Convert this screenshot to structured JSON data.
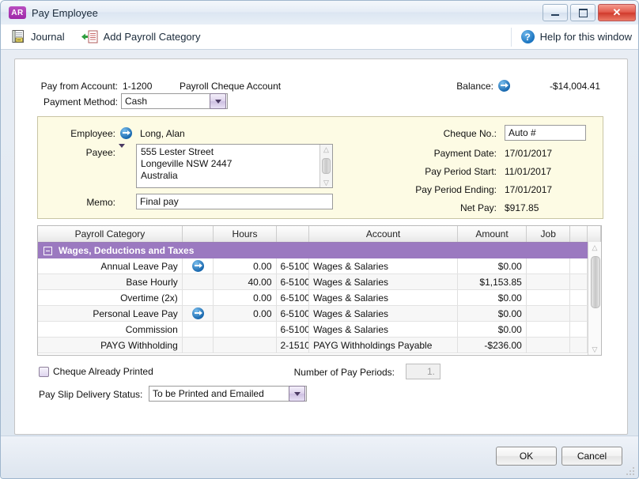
{
  "window": {
    "badge": "AR",
    "title": "Pay Employee",
    "minimize_icon": "minimize-icon",
    "maximize_icon": "maximize-icon",
    "close_icon": "close-icon"
  },
  "toolbar": {
    "journal_label": "Journal",
    "journal_icon": "journal-icon",
    "add_payroll_category_label": "Add Payroll Category",
    "add_payroll_category_icon": "add-document-icon",
    "help_label": "Help for this window",
    "help_icon": "help-icon"
  },
  "header": {
    "pay_from_account_label": "Pay from Account:",
    "pay_from_account_code": "1-1200",
    "pay_from_account_name": "Payroll Cheque Account",
    "payment_method_label": "Payment Method:",
    "payment_method_value": "Cash",
    "balance_label": "Balance:",
    "balance_value": "-$14,004.41"
  },
  "employee": {
    "employee_label": "Employee:",
    "employee_value": "Long, Alan",
    "payee_label": "Payee:",
    "payee_address_line1": "555 Lester Street",
    "payee_address_line2": "Longeville  NSW  2447",
    "payee_address_line3": "Australia",
    "memo_label": "Memo:",
    "memo_value": "Final pay",
    "cheque_no_label": "Cheque No.:",
    "cheque_no_value": "Auto #",
    "payment_date_label": "Payment Date:",
    "payment_date_value": "17/01/2017",
    "pay_period_start_label": "Pay Period Start:",
    "pay_period_start_value": "11/01/2017",
    "pay_period_ending_label": "Pay Period Ending:",
    "pay_period_ending_value": "17/01/2017",
    "net_pay_label": "Net Pay:",
    "net_pay_value": "$917.85"
  },
  "grid": {
    "columns": [
      "Payroll Category",
      "",
      "Hours",
      "",
      "Account",
      "Amount",
      "Job",
      "",
      ""
    ],
    "group_row": "Wages, Deductions and Taxes",
    "rows": [
      {
        "category": "Annual Leave Pay",
        "zoom": true,
        "hours": "0.00",
        "account_code": "6-5100",
        "account_name": "Wages & Salaries",
        "amount": "$0.00",
        "job": ""
      },
      {
        "category": "Base Hourly",
        "zoom": false,
        "hours": "40.00",
        "account_code": "6-5100",
        "account_name": "Wages & Salaries",
        "amount": "$1,153.85",
        "job": ""
      },
      {
        "category": "Overtime (2x)",
        "zoom": false,
        "hours": "0.00",
        "account_code": "6-5100",
        "account_name": "Wages & Salaries",
        "amount": "$0.00",
        "job": ""
      },
      {
        "category": "Personal Leave Pay",
        "zoom": true,
        "hours": "0.00",
        "account_code": "6-5100",
        "account_name": "Wages & Salaries",
        "amount": "$0.00",
        "job": ""
      },
      {
        "category": "Commission",
        "zoom": false,
        "hours": "",
        "account_code": "6-5100",
        "account_name": "Wages & Salaries",
        "amount": "$0.00",
        "job": ""
      },
      {
        "category": "PAYG Withholding",
        "zoom": false,
        "hours": "",
        "account_code": "2-1510",
        "account_name": "PAYG Withholdings Payable",
        "amount": "-$236.00",
        "job": ""
      }
    ]
  },
  "options": {
    "cheque_already_printed_label": "Cheque Already Printed",
    "cheque_already_printed_checked": false,
    "number_of_pay_periods_label": "Number of Pay Periods:",
    "number_of_pay_periods_value": "1.",
    "pay_slip_delivery_label": "Pay Slip Delivery Status:",
    "pay_slip_delivery_value": "To be Printed and Emailed"
  },
  "footer": {
    "ok_label": "OK",
    "cancel_label": "Cancel"
  },
  "colors": {
    "group_purple": "#9b79c0",
    "panel_yellow": "#fdfbe4",
    "accent_blue": "#1565ac"
  }
}
